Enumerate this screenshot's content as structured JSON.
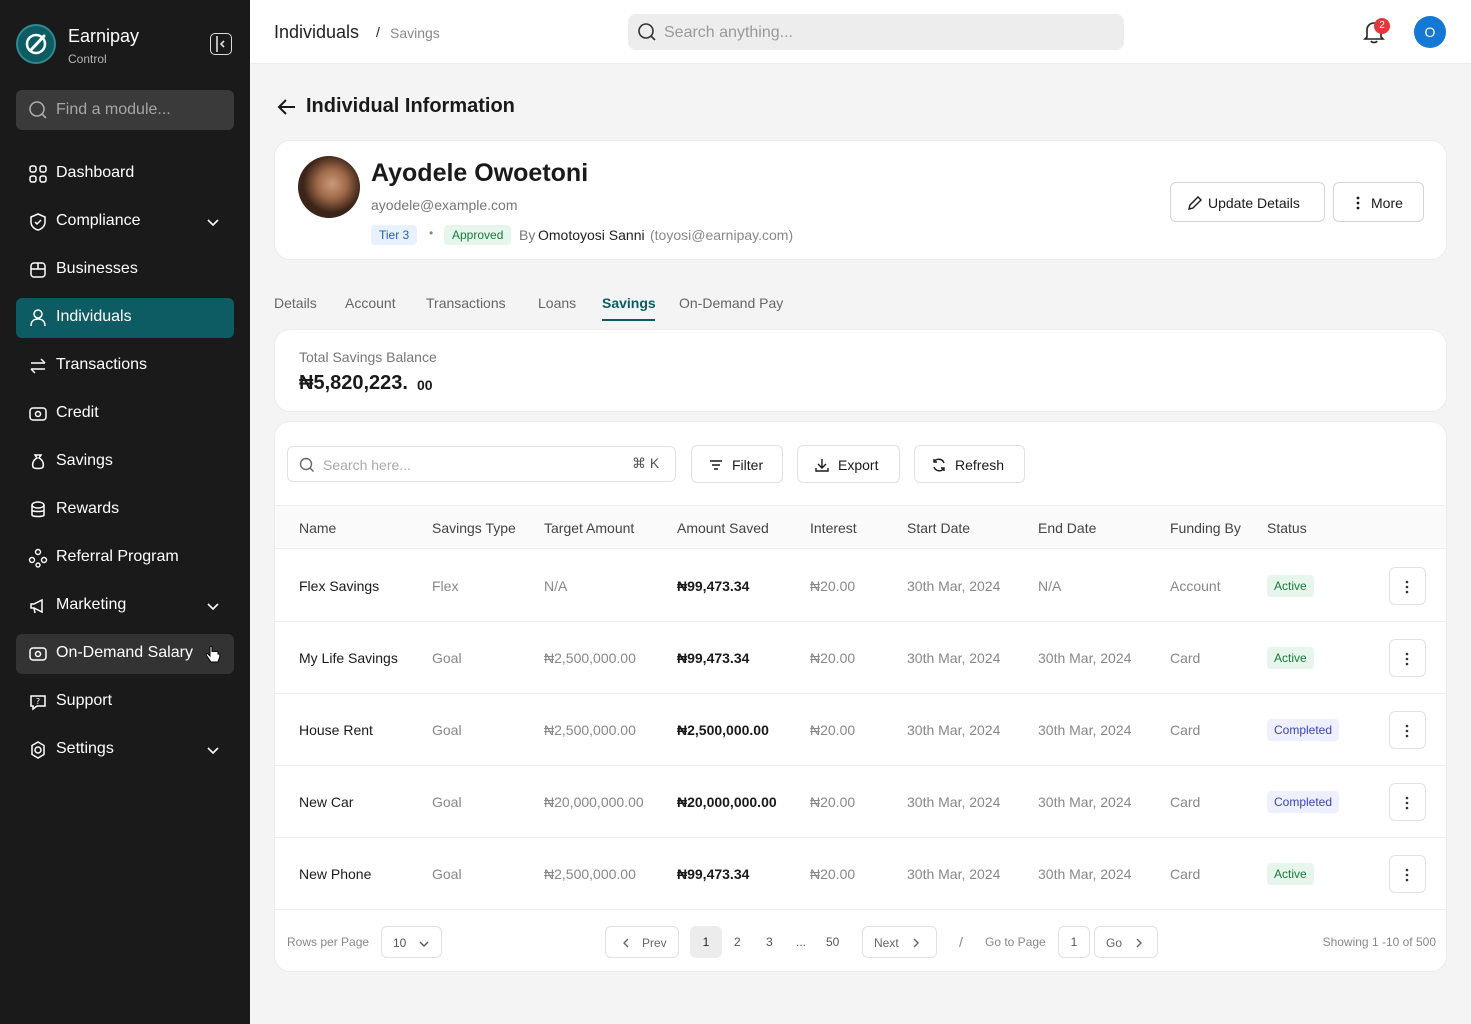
{
  "brand": {
    "name": "Earnipay",
    "sub": "Control"
  },
  "sidebar": {
    "search_placeholder": "Find a module...",
    "items": [
      {
        "label": "Dashboard"
      },
      {
        "label": "Compliance"
      },
      {
        "label": "Businesses"
      },
      {
        "label": "Individuals"
      },
      {
        "label": "Transactions"
      },
      {
        "label": "Credit"
      },
      {
        "label": "Savings"
      },
      {
        "label": "Rewards"
      },
      {
        "label": "Referral Program"
      },
      {
        "label": "Marketing"
      },
      {
        "label": "On-Demand Salary"
      },
      {
        "label": "Support"
      },
      {
        "label": "Settings"
      }
    ]
  },
  "header": {
    "crumb1": "Individuals",
    "sep": "/",
    "crumb2": "Savings",
    "search_placeholder": "Search anything...",
    "notif_count": "2",
    "avatar_initial": "O"
  },
  "page": {
    "title": "Individual Information"
  },
  "profile": {
    "name": "Ayodele Owoetoni",
    "email": "ayodele@example.com",
    "tier": "Tier 3",
    "dot": "•",
    "status": "Approved",
    "by": "By",
    "by_name": "Omotoyosi Sanni",
    "by_email": "(toyosi@earnipay.com)",
    "update_label": "Update Details",
    "more_label": "More"
  },
  "tabs": [
    "Details",
    "Account",
    "Transactions",
    "Loans",
    "Savings",
    "On-Demand Pay"
  ],
  "balance": {
    "label": "Total Savings Balance",
    "value": "₦5,820,223.",
    "decimal": "00"
  },
  "toolbar": {
    "search_placeholder": "Search here...",
    "kbd": "⌘ K",
    "filter": "Filter",
    "export": "Export",
    "refresh": "Refresh"
  },
  "table": {
    "headers": [
      "Name",
      "Savings Type",
      "Target Amount",
      "Amount Saved",
      "Interest",
      "Start Date",
      "End Date",
      "Funding By",
      "Status"
    ],
    "rows": [
      {
        "name": "Flex Savings",
        "type": "Flex",
        "target": "N/A",
        "saved": "₦99,473.34",
        "interest": "₦20.00",
        "start": "30th Mar, 2024",
        "end": "N/A",
        "funding": "Account",
        "status": "Active"
      },
      {
        "name": "My Life Savings",
        "type": "Goal",
        "target": "₦2,500,000.00",
        "saved": "₦99,473.34",
        "interest": "₦20.00",
        "start": "30th Mar, 2024",
        "end": "30th Mar, 2024",
        "funding": "Card",
        "status": "Active"
      },
      {
        "name": "House Rent",
        "type": "Goal",
        "target": "₦2,500,000.00",
        "saved": "₦2,500,000.00",
        "interest": "₦20.00",
        "start": "30th Mar, 2024",
        "end": "30th Mar, 2024",
        "funding": "Card",
        "status": "Completed"
      },
      {
        "name": "New Car",
        "type": "Goal",
        "target": "₦20,000,000.00",
        "saved": "₦20,000,000.00",
        "interest": "₦20.00",
        "start": "30th Mar, 2024",
        "end": "30th Mar, 2024",
        "funding": "Card",
        "status": "Completed"
      },
      {
        "name": "New Phone",
        "type": "Goal",
        "target": "₦2,500,000.00",
        "saved": "₦99,473.34",
        "interest": "₦20.00",
        "start": "30th Mar, 2024",
        "end": "30th Mar, 2024",
        "funding": "Card",
        "status": "Active"
      }
    ]
  },
  "pagination": {
    "rows_label": "Rows per Page",
    "rows_value": "10",
    "prev": "Prev",
    "pages": [
      "1",
      "2",
      "3",
      "...",
      "50"
    ],
    "next": "Next",
    "sep": "/",
    "goto_label": "Go to Page",
    "goto_value": "1",
    "go": "Go",
    "showing": "Showing 1 -10 of 500"
  },
  "colors": {
    "primary": "#0d5c63",
    "sidebar": "#1a1a1a",
    "badge": "#e5373b",
    "avatar": "#1479d4"
  }
}
